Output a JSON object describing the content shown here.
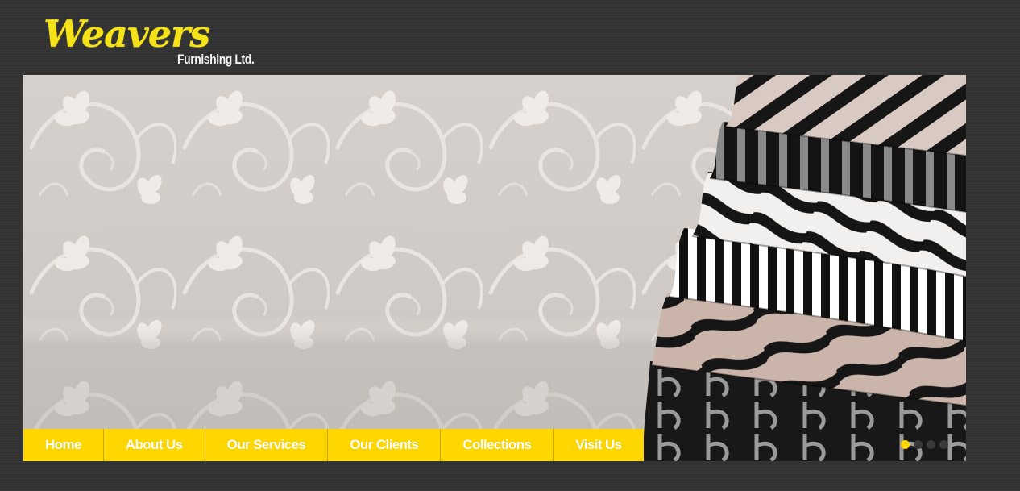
{
  "brand": {
    "logo_script": "Weavers",
    "logo_sub": "Furnishing Ltd."
  },
  "nav": {
    "items": [
      {
        "label": "Home"
      },
      {
        "label": "About Us"
      },
      {
        "label": "Our Services"
      },
      {
        "label": "Our Clients"
      },
      {
        "label": "Collections"
      },
      {
        "label": "Visit Us"
      }
    ]
  },
  "slider": {
    "slide_count": 4,
    "active_slide": 1
  },
  "colors": {
    "background": "#333333",
    "accent": "#ffd600",
    "nav_text": "#ffffff",
    "logo_text": "#f6e21a"
  }
}
